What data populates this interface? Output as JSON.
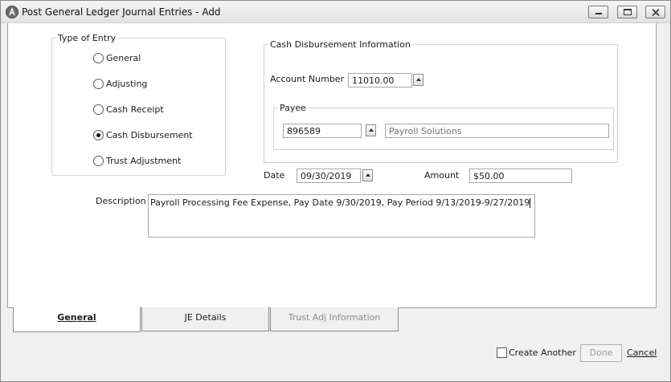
{
  "window": {
    "title": "Post General Ledger Journal Entries - Add",
    "icon": "app-logo-icon"
  },
  "type_of_entry": {
    "legend": "Type of Entry",
    "options": [
      {
        "label": "General",
        "checked": false
      },
      {
        "label": "Adjusting",
        "checked": false
      },
      {
        "label": "Cash Receipt",
        "checked": false
      },
      {
        "label": "Cash Disbursement",
        "checked": true
      },
      {
        "label": "Trust Adjustment",
        "checked": false
      }
    ]
  },
  "cash_disbursement": {
    "legend": "Cash Disbursement Information",
    "account_label": "Account Number",
    "account_value": "11010.00",
    "payee": {
      "legend": "Payee",
      "id_value": "896589",
      "name_value": "Payroll Solutions"
    }
  },
  "date": {
    "label": "Date",
    "value": "09/30/2019"
  },
  "amount": {
    "label": "Amount",
    "value": "$50.00"
  },
  "description": {
    "label": "Description",
    "value": "Payroll Processing Fee Expense, Pay Date 9/30/2019, Pay Period 9/13/2019-9/27/2019"
  },
  "tabs": [
    {
      "label": "General",
      "state": "active"
    },
    {
      "label": "JE Details",
      "state": "normal"
    },
    {
      "label": "Trust Adj Information",
      "state": "disabled"
    }
  ],
  "footer": {
    "create_another_label": "Create Another",
    "done_label": "Done",
    "cancel_label": "Cancel"
  }
}
